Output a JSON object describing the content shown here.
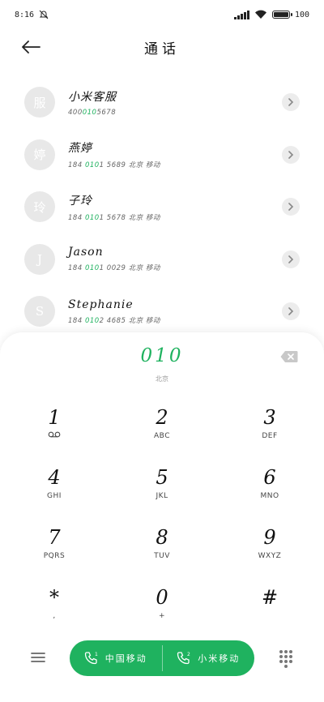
{
  "status": {
    "time": "8:16",
    "battery": "100"
  },
  "header": {
    "title": "通话"
  },
  "contacts": [
    {
      "avatar_char": "服",
      "name": "小米客服",
      "number_pre": "400",
      "number_hl": "010",
      "number_post": "5678",
      "location": ""
    },
    {
      "avatar_char": "婷",
      "name": "燕婷",
      "number_pre": "184 ",
      "number_hl": "010",
      "number_post": "1 5689",
      "location": "北京 移动"
    },
    {
      "avatar_char": "玲",
      "name": "子玲",
      "number_pre": "184 ",
      "number_hl": "010",
      "number_post": "1 5678",
      "location": "北京 移动"
    },
    {
      "avatar_char": "J",
      "name": "Jason",
      "number_pre": "184 ",
      "number_hl": "010",
      "number_post": "1 0029",
      "location": "北京 移动"
    },
    {
      "avatar_char": "S",
      "name": "Stephanie",
      "number_pre": "184 ",
      "number_hl": "010",
      "number_post": "2 4685",
      "location": "北京 移动"
    }
  ],
  "dialer": {
    "number": "010",
    "location": "北京",
    "keys": [
      {
        "digit": "1",
        "letters": ""
      },
      {
        "digit": "2",
        "letters": "ABC"
      },
      {
        "digit": "3",
        "letters": "DEF"
      },
      {
        "digit": "4",
        "letters": "GHI"
      },
      {
        "digit": "5",
        "letters": "JKL"
      },
      {
        "digit": "6",
        "letters": "MNO"
      },
      {
        "digit": "7",
        "letters": "PQRS"
      },
      {
        "digit": "8",
        "letters": "TUV"
      },
      {
        "digit": "9",
        "letters": "WXYZ"
      },
      {
        "digit": "*",
        "letters": ","
      },
      {
        "digit": "0",
        "letters": "+"
      },
      {
        "digit": "#",
        "letters": ""
      }
    ]
  },
  "call": {
    "sim1_label": "中国移动",
    "sim2_label": "小米移动"
  },
  "colors": {
    "accent": "#1fb25f",
    "avatar_bg": "#e8e8e8"
  },
  "icons": {
    "back": "arrow-left-icon",
    "chevron": "chevron-right-icon",
    "backspace": "backspace-icon",
    "voicemail": "voicemail-icon",
    "menu": "hamburger-menu-icon",
    "keypad": "keypad-grid-icon",
    "phone": "phone-icon"
  }
}
